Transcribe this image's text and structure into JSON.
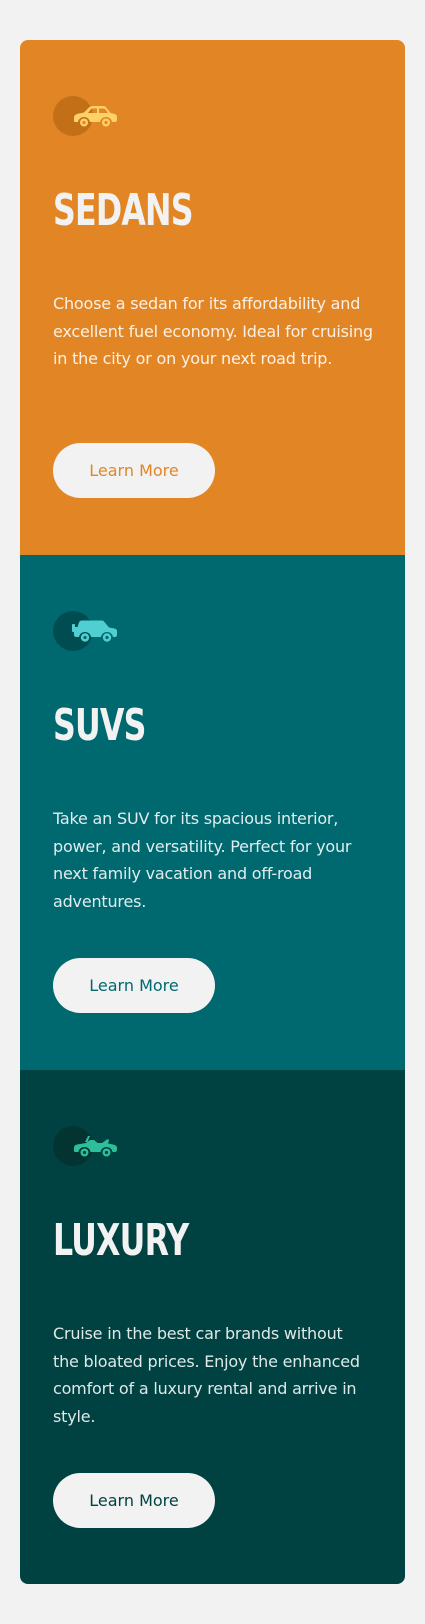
{
  "cards": [
    {
      "id": "sedans",
      "icon": "sedan-car-icon",
      "title": "SEDANS",
      "description": "Choose a sedan for its affordability and excellent fuel economy. Ideal for cruising in the city or on your next road trip.",
      "button_label": "Learn More",
      "background_color": "#e28625",
      "icon_color": "#fdd068"
    },
    {
      "id": "suvs",
      "icon": "suv-car-icon",
      "title": "SUVS",
      "description": "Take an SUV for its spacious interior, power, and versatility. Perfect for your next family vacation and off-road adventures.",
      "button_label": "Learn More",
      "background_color": "#006970",
      "icon_color": "#4fcfd1"
    },
    {
      "id": "luxury",
      "icon": "luxury-car-icon",
      "title": "LUXURY",
      "description": "Cruise in the best car brands without the bloated prices. Enjoy the enhanced comfort of a luxury rental and arrive in style.",
      "button_label": "Learn More",
      "background_color": "#004241",
      "icon_color": "#2cbf9a"
    }
  ]
}
